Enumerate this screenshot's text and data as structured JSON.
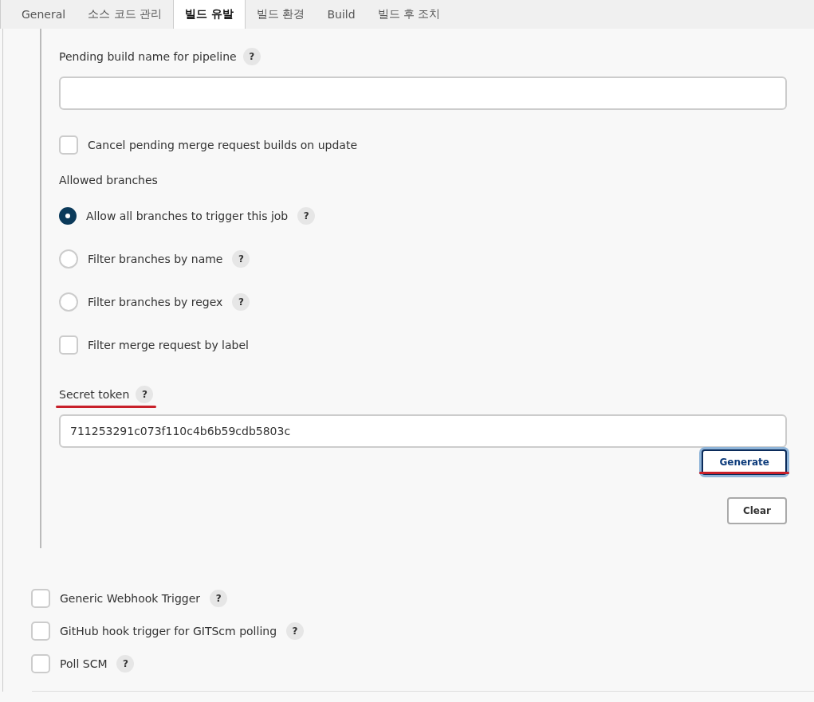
{
  "tabs": [
    {
      "label": "General",
      "selected": false
    },
    {
      "label": "소스 코드 관리",
      "selected": false
    },
    {
      "label": "빌드 유발",
      "selected": true
    },
    {
      "label": "빌드 환경",
      "selected": false
    },
    {
      "label": "Build",
      "selected": false
    },
    {
      "label": "빌드 후 조치",
      "selected": false
    }
  ],
  "pending_build_name": {
    "label": "Pending build name for pipeline",
    "help": "?"
  },
  "options": [
    {
      "kind": "checkbox",
      "label": "Cancel pending merge request builds on update",
      "checked": false
    }
  ],
  "allowed_branches": {
    "label": "Allowed branches",
    "items": [
      {
        "kind": "radio",
        "label": "Allow all branches to trigger this job",
        "help": "?",
        "selected": true
      },
      {
        "kind": "radio",
        "label": "Filter branches by name",
        "help": "?",
        "selected": false
      },
      {
        "kind": "radio",
        "label": "Filter branches by regex",
        "help": "?",
        "selected": false
      },
      {
        "kind": "checkbox",
        "label": "Filter merge request by label",
        "checked": false
      }
    ]
  },
  "secret_token": {
    "label": "Secret token",
    "help": "?",
    "highlighted": true,
    "value": "711253291c073f110c4b6b59cdb5803c"
  },
  "buttons": [
    {
      "label": "Generate",
      "focused": true,
      "highlighted": true
    },
    {
      "label": "Clear",
      "focused": false,
      "highlighted": false
    }
  ],
  "triggers": [
    {
      "label": "Generic Webhook Trigger",
      "help": "?",
      "checked": false
    },
    {
      "label": "GitHub hook trigger for GITScm polling",
      "help": "?",
      "checked": false
    },
    {
      "label": "Poll SCM",
      "help": "?",
      "checked": false
    }
  ]
}
